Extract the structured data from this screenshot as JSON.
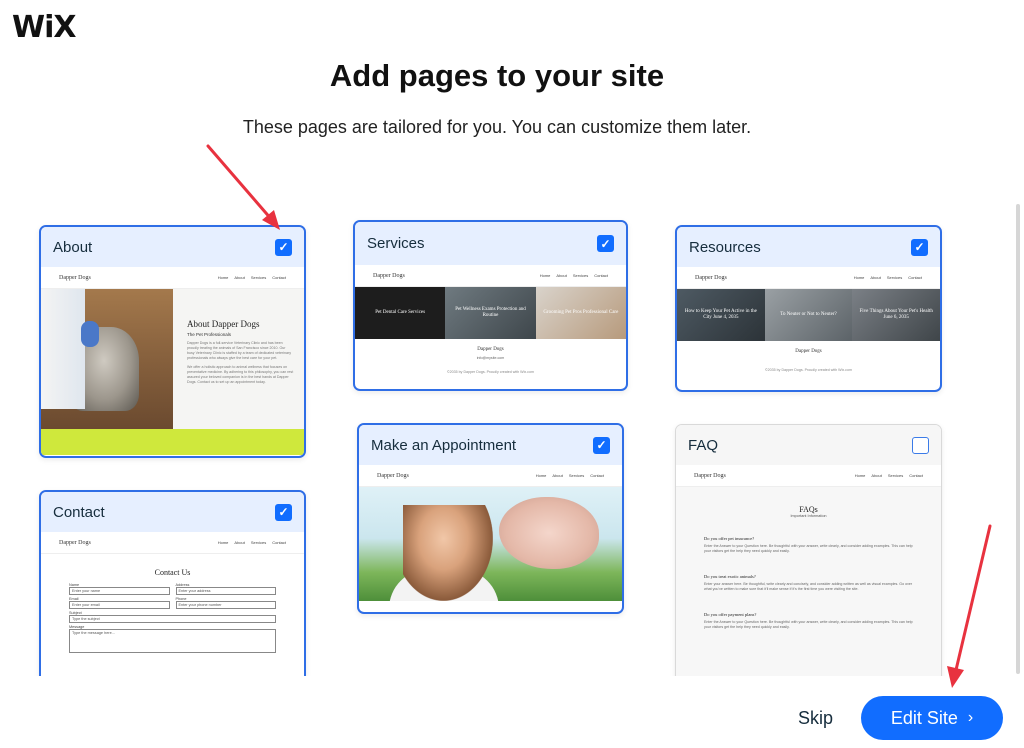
{
  "logo": "WiX",
  "title": "Add pages to your site",
  "subtitle": "These pages are tailored for you. You can customize them later.",
  "brand": "Dapper Dogs",
  "nav_links": [
    "Home",
    "About",
    "Services",
    "Contact"
  ],
  "cards": {
    "about": {
      "title": "About",
      "checked": true,
      "heading": "About Dapper Dogs",
      "sub": "The Pet Professionals",
      "p1": "Dapper Dogs is a full-service Veterinary Clinic and has been proudly treating the animals of San Francisco since 2010. Our busy Veterinary Clinic is staffed by a team of dedicated veterinary professionals who always give the best care for your pet.",
      "p2": "We offer a holistic approach to animal wellness that focuses on preventative medicine. By adhering to this philosophy, you can rest assured your beloved companion is in the best hands at Dapper Dogs. Contact us to set up an appointment today."
    },
    "services": {
      "title": "Services",
      "checked": true,
      "strip": [
        "Pet Dental Care Services",
        "Pet Wellness Exams Protection and Routine",
        "Grooming Pet Pros Professional Care"
      ],
      "email": "info@mysite.com",
      "copy": "©2035 by Dapper Dogs. Proudly created with Wix.com"
    },
    "resources": {
      "title": "Resources",
      "checked": true,
      "strip": [
        "How to Keep Your Pet Active in the City June 4, 2035",
        "To Neuter or Not to Neuter?",
        "Five Things About Your Pet's Health June 6, 2035"
      ],
      "copy": "©2035 by Dapper Dogs. Proudly created with Wix.com"
    },
    "appointment": {
      "title": "Make an Appointment",
      "checked": true
    },
    "contact": {
      "title": "Contact",
      "checked": true,
      "heading": "Contact Us",
      "name_label": "Name",
      "name_ph": "Enter your name",
      "address_label": "Address",
      "address_ph": "Enter your address",
      "email_label": "Email",
      "email_ph": "Enter your email",
      "phone_label": "Phone",
      "phone_ph": "Enter your phone number",
      "subject_label": "Subject",
      "subject_ph": "Type the subject",
      "message_label": "Message",
      "message_ph": "Type the message here..."
    },
    "faq": {
      "title": "FAQ",
      "checked": false,
      "heading": "FAQs",
      "sub": "Important Information",
      "q1": "Do you offer pet insurance?",
      "a1": "Enter the Answer to your Question here. Be thoughtful with your answer, write clearly, and consider adding examples. This can help your visitors get the help they need quickly and easily.",
      "q2": "Do you treat exotic animals?",
      "a2": "Enter your answer here. Be thoughtful, write clearly and concisely, and consider adding written as well as visual examples. Go over what you've written to make sure that it'll make sense if it's the first time you were visiting the site.",
      "q3": "Do you offer payment plans?",
      "a3": "Enter the Answer to your Question here. Be thoughtful with your answer, write clearly, and consider adding examples. This can help your visitors get the help they need quickly and easily."
    }
  },
  "checkmark": "✓",
  "footer": {
    "skip": "Skip",
    "edit": "Edit Site",
    "chevron": "›"
  },
  "colors": {
    "accent": "#116dff",
    "card_border": "#2f6ee6",
    "card_header": "#e6efff",
    "annotation_arrow": "#e8323f"
  }
}
